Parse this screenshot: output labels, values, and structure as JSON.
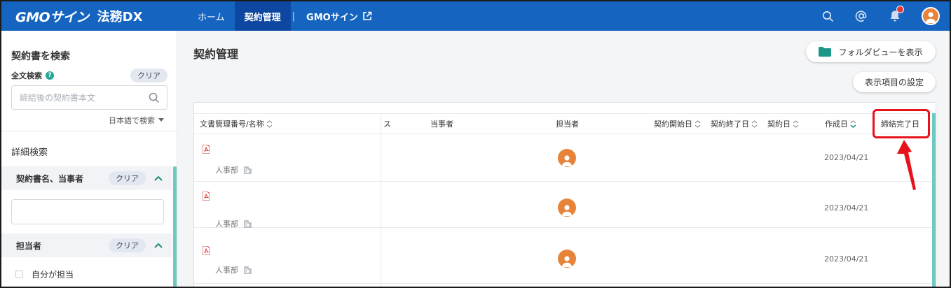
{
  "brand": {
    "name": "GMOサイン",
    "product": "法務DX"
  },
  "nav": {
    "items": [
      {
        "label": "ホーム"
      },
      {
        "label": "契約管理"
      },
      {
        "label": "GMOサイン"
      }
    ],
    "separator": "|",
    "active": "契約管理"
  },
  "sidebar": {
    "title": "契約書を検索",
    "fulltext_label": "全文検索",
    "help_glyph": "?",
    "clear_label": "クリア",
    "search_placeholder": "締結後の契約書本文",
    "lang_label": "日本語で検索",
    "detail_label": "詳細検索",
    "sections": [
      {
        "title": "契約書名、当事者",
        "clear_label": "クリア"
      },
      {
        "title": "担当者",
        "clear_label": "クリア"
      }
    ],
    "checkbox_label": "自分が担当"
  },
  "main": {
    "title": "契約管理",
    "folder_view_button": "フォルダビューを表示",
    "column_settings_button": "表示項目の設定"
  },
  "table": {
    "columns": [
      "文書管理番号/名称",
      "ス",
      "当事者",
      "担当者",
      "契約開始日",
      "契約終了日",
      "契約日",
      "作成日",
      "締結完了日"
    ],
    "rows": [
      {
        "department": "人事部",
        "created": "2023/04/21"
      },
      {
        "department": "人事部",
        "created": "2023/04/21"
      },
      {
        "department": "人事部",
        "created": "2023/04/21"
      }
    ]
  },
  "colors": {
    "header_bg": "#1565c0",
    "header_active": "#0d47a1",
    "accent_teal": "#26a69a",
    "avatar_orange": "#e8843a",
    "highlight_red": "#e8121b",
    "pdf_red": "#d32f2f"
  }
}
